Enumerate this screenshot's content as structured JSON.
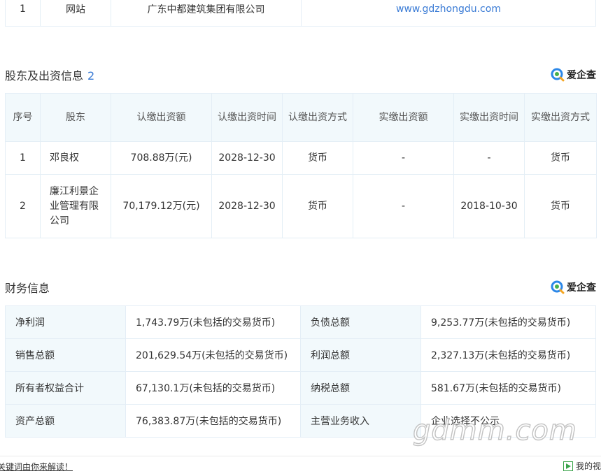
{
  "website_table": {
    "rows": [
      {
        "index": "1",
        "type": "网站",
        "name": "广东中都建筑集团有限公司",
        "url": "www.gdzhongdu.com"
      }
    ]
  },
  "shareholders": {
    "title": "股东及出资信息",
    "count": "2",
    "logo_text": "爱企查",
    "headers": [
      "序号",
      "股东",
      "认缴出资额",
      "认缴出资时间",
      "认缴出资方式",
      "实缴出资额",
      "实缴出资时间",
      "实缴出资方式"
    ],
    "rows": [
      {
        "index": "1",
        "holder": "邓良权",
        "subscribed_amount": "708.88万(元)",
        "subscribed_date": "2028-12-30",
        "subscribed_method": "货币",
        "paid_amount": "-",
        "paid_date": "-",
        "paid_method": "货币"
      },
      {
        "index": "2",
        "holder": "廉江利景企业管理有限公司",
        "subscribed_amount": "70,179.12万(元)",
        "subscribed_date": "2028-12-30",
        "subscribed_method": "货币",
        "paid_amount": "-",
        "paid_date": "2018-10-30",
        "paid_method": "货币"
      }
    ]
  },
  "finance": {
    "title": "财务信息",
    "logo_text": "爱企查",
    "rows": [
      {
        "label1": "净利润",
        "value1": "1,743.79万(未包括的交易货币)",
        "label2": "负债总额",
        "value2": "9,253.77万(未包括的交易货币)"
      },
      {
        "label1": "销售总额",
        "value1": "201,629.54万(未包括的交易货币)",
        "label2": "利润总额",
        "value2": "2,327.13万(未包括的交易货币)"
      },
      {
        "label1": "所有者权益合计",
        "value1": "67,130.1万(未包括的交易货币)",
        "label2": "纳税总额",
        "value2": "581.67万(未包括的交易货币)"
      },
      {
        "label1": "资产总额",
        "value1": "76,383.87万(未包括的交易货币)",
        "label2": "主营业务收入",
        "value2": "企业选择不公示"
      }
    ]
  },
  "watermark": "gdmm.com",
  "bottom_bar": {
    "left_text": "关键词由你来解读！",
    "right_text": "我的视"
  },
  "colors": {
    "accent": "#3a7bd5",
    "header_bg": "#f2f9fc",
    "border": "#e4eef6",
    "logo_green": "#47b04b",
    "logo_blue": "#2c88e8"
  }
}
